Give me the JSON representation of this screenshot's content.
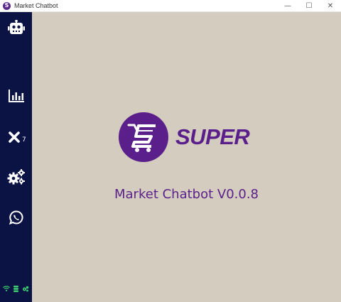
{
  "window": {
    "title": "Market Chatbot",
    "app_icon_letter": "S",
    "controls": {
      "minimize": "—",
      "maximize": "☐",
      "close": "✕"
    }
  },
  "sidebar": {
    "background": "#0b1244",
    "items": [
      {
        "name": "chatbot",
        "icon": "robot-icon"
      },
      {
        "name": "statistics",
        "icon": "bar-chart-icon"
      },
      {
        "name": "rejected",
        "icon": "close-icon",
        "badge": "7"
      },
      {
        "name": "settings",
        "icon": "gears-icon"
      },
      {
        "name": "whatsapp",
        "icon": "whatsapp-icon"
      }
    ],
    "status_icons": [
      "wifi-icon",
      "database-icon",
      "gear-status-icon"
    ],
    "status_color": "#3bd16f"
  },
  "main": {
    "background": "#d4cdbf",
    "brand": "SUPER",
    "brand_color": "#5a1f8a",
    "version_text": "Market Chatbot V0.0.8"
  }
}
